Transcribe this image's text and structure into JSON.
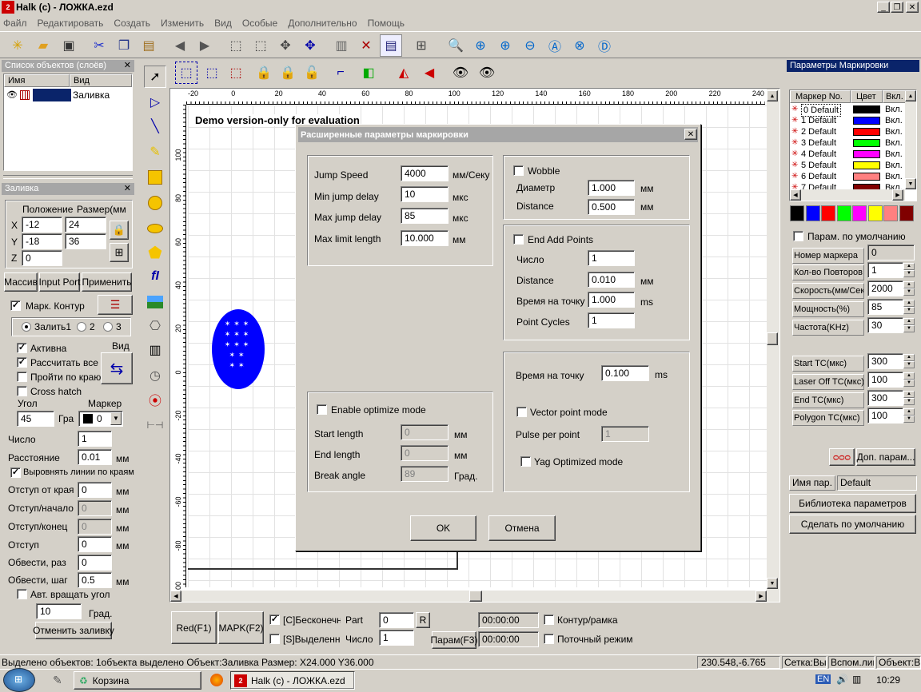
{
  "window": {
    "title": "Halk (c) - ЛОЖКА.ezd",
    "min": "_",
    "max": "❐",
    "close": "✕"
  },
  "menu": [
    "Файл",
    "Редактировать",
    "Создать",
    "Изменить",
    "Вид",
    "Особые",
    "Дополнительно",
    "Помощь"
  ],
  "objects_panel": {
    "title": "Список объектов (слоёв)",
    "col_name": "Имя",
    "col_view": "Вид",
    "row_view": "Заливка"
  },
  "fill_panel": {
    "title": "Заливка",
    "pos_label": "Положение",
    "size_label": "Размер(мм",
    "x_label": "X",
    "y_label": "Y",
    "z_label": "Z",
    "x": "-12",
    "y": "-18",
    "z": "0",
    "w": "24",
    "h": "36",
    "btn_massive": "Массив",
    "btn_input_port": "Input Port",
    "btn_apply": "Применить",
    "mark_contour": "Марк. Контур",
    "fill1": "Залить1",
    "fill2": "2",
    "fill3": "3",
    "active": "Активна",
    "view_label": "Вид",
    "calc_all": "Рассчитать все",
    "go_edge": "Пройти по краю",
    "cross_hatch": "Cross hatch",
    "angle_label": "Угол",
    "marker_label": "Маркер",
    "angle": "45",
    "angle_unit": "Гра",
    "marker_val": "0",
    "count_label": "Число",
    "count": "1",
    "dist_label": "Расстояние",
    "dist": "0.01",
    "dist_unit": "мм",
    "align_lines": "Выровнять линии по краям",
    "edge_off_label": "Отступ от края",
    "edge_off": "0",
    "start_off_label": "Отступ/начало",
    "start_off": "0",
    "end_off_label": "Отступ/конец",
    "end_off": "0",
    "off_label": "Отступ",
    "off": "0",
    "bypass_label": "Обвести, раз",
    "bypass": "0",
    "bypass_step_label": "Обвести, шаг",
    "bypass_step": "0.5",
    "auto_rotate": "Авт. вращать угол",
    "rotate_val": "10",
    "rotate_unit": "Град.",
    "cancel_fill": "Отменить заливку",
    "mm": "мм"
  },
  "canvas": {
    "demo": "Demo version-only for evaluation",
    "ruler_top": [
      "-20",
      "0",
      "20",
      "40",
      "60",
      "80",
      "100",
      "120",
      "140",
      "160",
      "180",
      "200",
      "220",
      "240"
    ],
    "ruler_left": [
      "100",
      "80",
      "60",
      "40",
      "20",
      "0",
      "-20",
      "-40",
      "-60",
      "-80",
      "-100"
    ]
  },
  "dialog": {
    "title": "Расширенные параметры маркировки",
    "close": "✕",
    "jump_speed_label": "Jump Speed",
    "jump_speed": "4000",
    "jump_speed_unit": "мм/Секу",
    "min_jump_label": "Min jump delay",
    "min_jump": "10",
    "min_jump_unit": "мкс",
    "max_jump_label": "Max jump delay",
    "max_jump": "85",
    "max_jump_unit": "мкс",
    "max_limit_label": "Max limit length",
    "max_limit": "10.000",
    "max_limit_unit": "мм",
    "wobble": "Wobble",
    "diam_label": "Диаметр",
    "diam": "1.000",
    "diam_unit": "мм",
    "wdist_label": "Distance",
    "wdist": "0.500",
    "wdist_unit": "мм",
    "end_add": "End Add Points",
    "num_label": "Число",
    "num": "1",
    "edist_label": "Distance",
    "edist": "0.010",
    "edist_unit": "мм",
    "time_pt_label": "Время на точку",
    "time_pt": "1.000",
    "time_pt_unit": "ms",
    "cycles_label": "Point Cycles",
    "cycles": "1",
    "opt_mode": "Enable optimize mode",
    "start_len_label": "Start length",
    "start_len": "0",
    "start_len_unit": "мм",
    "end_len_label": "End length",
    "end_len": "0",
    "end_len_unit": "мм",
    "break_label": "Break angle",
    "break": "89",
    "break_unit": "Град.",
    "time_pt2_label": "Время на точку",
    "time_pt2": "0.100",
    "time_pt2_unit": "ms",
    "vector_mode": "Vector point mode",
    "pulse_label": "Pulse per point",
    "pulse": "1",
    "yag": "Yag Optimized mode",
    "ok": "OK",
    "cancel": "Отмена"
  },
  "right_panel": {
    "title": "Параметры Маркировки",
    "col_marker": "Маркер No.",
    "col_color": "Цвет",
    "col_on": "Вкл.",
    "markers": [
      {
        "name": "0 Default",
        "color": "#000000",
        "on": "Вкл."
      },
      {
        "name": "1 Default",
        "color": "#0000ff",
        "on": "Вкл."
      },
      {
        "name": "2 Default",
        "color": "#ff0000",
        "on": "Вкл."
      },
      {
        "name": "3 Default",
        "color": "#00ff00",
        "on": "Вкл."
      },
      {
        "name": "4 Default",
        "color": "#ff00ff",
        "on": "Вкл."
      },
      {
        "name": "5 Default",
        "color": "#ffff00",
        "on": "Вкл."
      },
      {
        "name": "6 Default",
        "color": "#ff8080",
        "on": "Вкл."
      },
      {
        "name": "7 Default",
        "color": "#800000",
        "on": "Вкл."
      }
    ],
    "palette": [
      "#000000",
      "#0000ff",
      "#ff0000",
      "#00ff00",
      "#ff00ff",
      "#ffff00",
      "#ff8080",
      "#800000"
    ],
    "default_params": "Парам. по умолчанию",
    "marker_no_label": "Номер маркера",
    "marker_no": "0",
    "repeat_label": "Кол-во Повторов",
    "repeat": "1",
    "speed_label": "Скорость(мм/Сек",
    "speed": "2000",
    "power_label": "Мощность(%)",
    "power": "85",
    "freq_label": "Частота(KHz)",
    "freq": "30",
    "start_tc_label": "Start TC(мкс)",
    "start_tc": "300",
    "laser_off_label": "Laser Off TC(мкс)",
    "laser_off": "100",
    "end_tc_label": "End TC(мкс)",
    "end_tc": "300",
    "poly_tc_label": "Polygon TC(мкс)",
    "poly_tc": "100",
    "extra_params": "Доп. парам...",
    "param_name_label": "Имя пар.",
    "param_name": "Default",
    "lib_btn": "Библиотека параметров",
    "default_btn": "Сделать по умолчанию"
  },
  "bottom": {
    "red": "Red(F1)",
    "mark": "MAPK(F2)",
    "infinite": "[C]Бесконечн",
    "part_label": "Part",
    "part": "0",
    "r_btn": "R",
    "selected": "[S]Выделенно",
    "count_label": "Число",
    "count": "1",
    "param_btn": "Парам(F3)",
    "time1": "00:00:00",
    "time2": "00:00:00",
    "contour": "Контур/рамка",
    "stream": "Поточный режим"
  },
  "status": {
    "text": "Выделено объектов: 1объекта выделено Объект:Заливка Размер: X24.000 Y36.000",
    "coords": "230.548,-6.765",
    "grid": "Сетка:Вык",
    "aux": "Вспом.лин",
    "obj": "Объект:Вык"
  },
  "taskbar": {
    "recycle": "Корзина",
    "app": "Halk (c) - ЛОЖКА.ezd",
    "lang": "EN",
    "clock": "10:29"
  }
}
